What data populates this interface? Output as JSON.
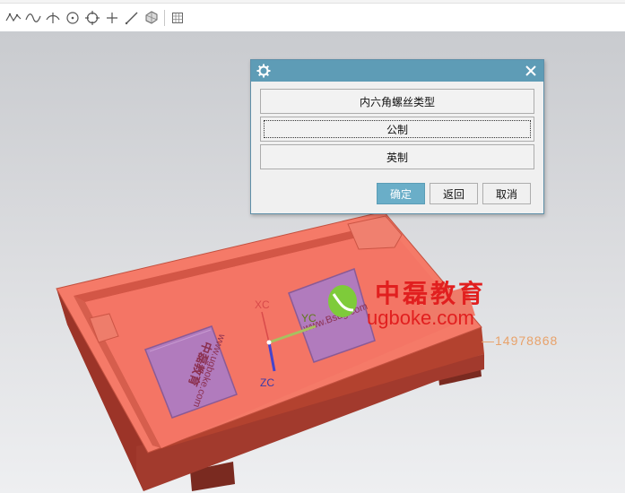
{
  "toolbar": {
    "icons": [
      "studio-spline-icon",
      "general-curve-icon",
      "intersection-curve-icon",
      "circle-icon",
      "circle-center-icon",
      "point-icon",
      "line-icon",
      "3d-view-icon",
      "grid-icon"
    ]
  },
  "viewport": {
    "axes": {
      "x": "XC",
      "y": "YC",
      "z": "ZC"
    },
    "part_labels": {
      "left_pad": "www.ugboke.com",
      "right_pad": "www.Bsug.com"
    }
  },
  "dialog": {
    "options": [
      "内六角螺丝类型",
      "公制",
      "英制"
    ],
    "ok_label": "确定",
    "back_label": "返回",
    "cancel_label": "取消"
  },
  "watermark": {
    "brand": "中磊教育",
    "url": "ugboke.com",
    "phone": "14978868"
  },
  "colors": {
    "dialog_title": "#5e9cb6",
    "ok_button": "#6aaec8",
    "part_top": "#f47a68",
    "part_side": "#a03528",
    "pad": "#b477b8",
    "watermark": "#e11f1f"
  }
}
